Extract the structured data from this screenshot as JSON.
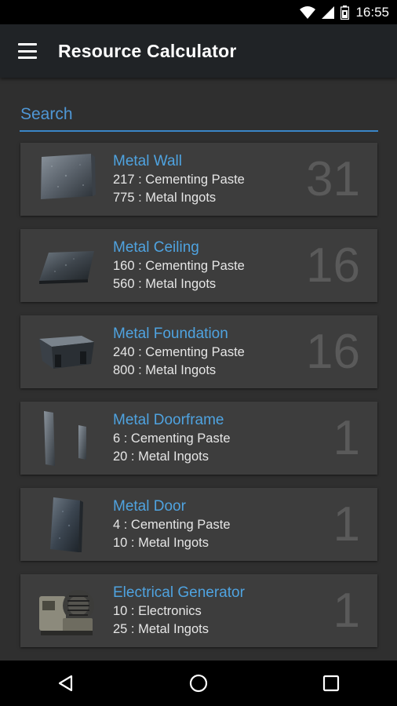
{
  "status_bar": {
    "time": "16:55",
    "icons": [
      "wifi-icon",
      "signal-icon",
      "battery-icon"
    ]
  },
  "app_bar": {
    "title": "Resource Calculator",
    "menu_icon": "hamburger-menu-icon"
  },
  "search": {
    "placeholder": "Search",
    "value": ""
  },
  "items": [
    {
      "name": "Metal Wall",
      "line1": "217 : Cementing Paste",
      "line2": "775 : Metal Ingots",
      "count": "31",
      "icon": "metal-wall-icon"
    },
    {
      "name": "Metal Ceiling",
      "line1": "160 : Cementing Paste",
      "line2": "560 : Metal Ingots",
      "count": "16",
      "icon": "metal-ceiling-icon"
    },
    {
      "name": "Metal Foundation",
      "line1": "240 : Cementing Paste",
      "line2": "800 : Metal Ingots",
      "count": "16",
      "icon": "metal-foundation-icon"
    },
    {
      "name": "Metal Doorframe",
      "line1": "6 : Cementing Paste",
      "line2": "20 : Metal Ingots",
      "count": "1",
      "icon": "metal-doorframe-icon"
    },
    {
      "name": "Metal Door",
      "line1": "4 : Cementing Paste",
      "line2": "10 : Metal Ingots",
      "count": "1",
      "icon": "metal-door-icon"
    },
    {
      "name": "Electrical Generator",
      "line1": "10 : Electronics",
      "line2": "25 : Metal Ingots",
      "count": "1",
      "icon": "electrical-generator-icon"
    }
  ],
  "nav_bar": {
    "buttons": [
      "back-icon",
      "home-icon",
      "recents-icon"
    ]
  },
  "colors": {
    "accent": "#4fa3e0",
    "appbar": "#202326",
    "background": "#2f2f2f",
    "card": "#3d3d3d"
  }
}
